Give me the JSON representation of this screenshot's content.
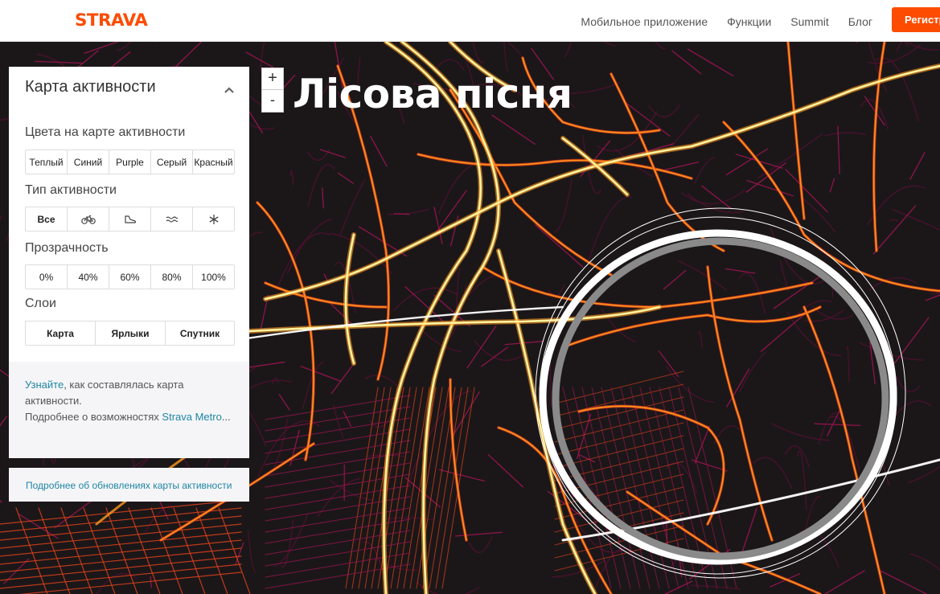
{
  "brand": {
    "logo_text": "STRAVA",
    "accent": "#fc4c02"
  },
  "nav": {
    "links": [
      "Мобильное приложение",
      "Функции",
      "Summit",
      "Блог"
    ],
    "register_label": "Регистрация"
  },
  "map": {
    "title": "Лісова пісня",
    "zoom_in": "+",
    "zoom_out": "-",
    "heat_colors": [
      "#fff3a0",
      "#ff9a1f",
      "#e8431a",
      "#9b1450",
      "#5a0f35"
    ]
  },
  "panel": {
    "title": "Карта активности",
    "colors_label": "Цвета на карте активности",
    "colors": [
      "Теплый",
      "Синий",
      "Purple",
      "Серый",
      "Красный"
    ],
    "activity_label": "Тип активности",
    "activity_all": "Все",
    "activity_icons": [
      "bike-icon",
      "shoe-icon",
      "water-icon",
      "snowflake-icon"
    ],
    "opacity_label": "Прозрачность",
    "opacity": [
      "0%",
      "40%",
      "60%",
      "80%",
      "100%"
    ],
    "layers_label": "Слои",
    "layers": [
      "Карта",
      "Ярлыки",
      "Спутник"
    ],
    "footer": {
      "learn_link": "Узнайте",
      "learn_text": ", как составлялась карта активности.",
      "more_text": "Подробнее о возможностях ",
      "metro_link": "Strava Metro",
      "ellipsis": "..."
    }
  },
  "updates_link": "Подробнее об обновлениях карты активности"
}
